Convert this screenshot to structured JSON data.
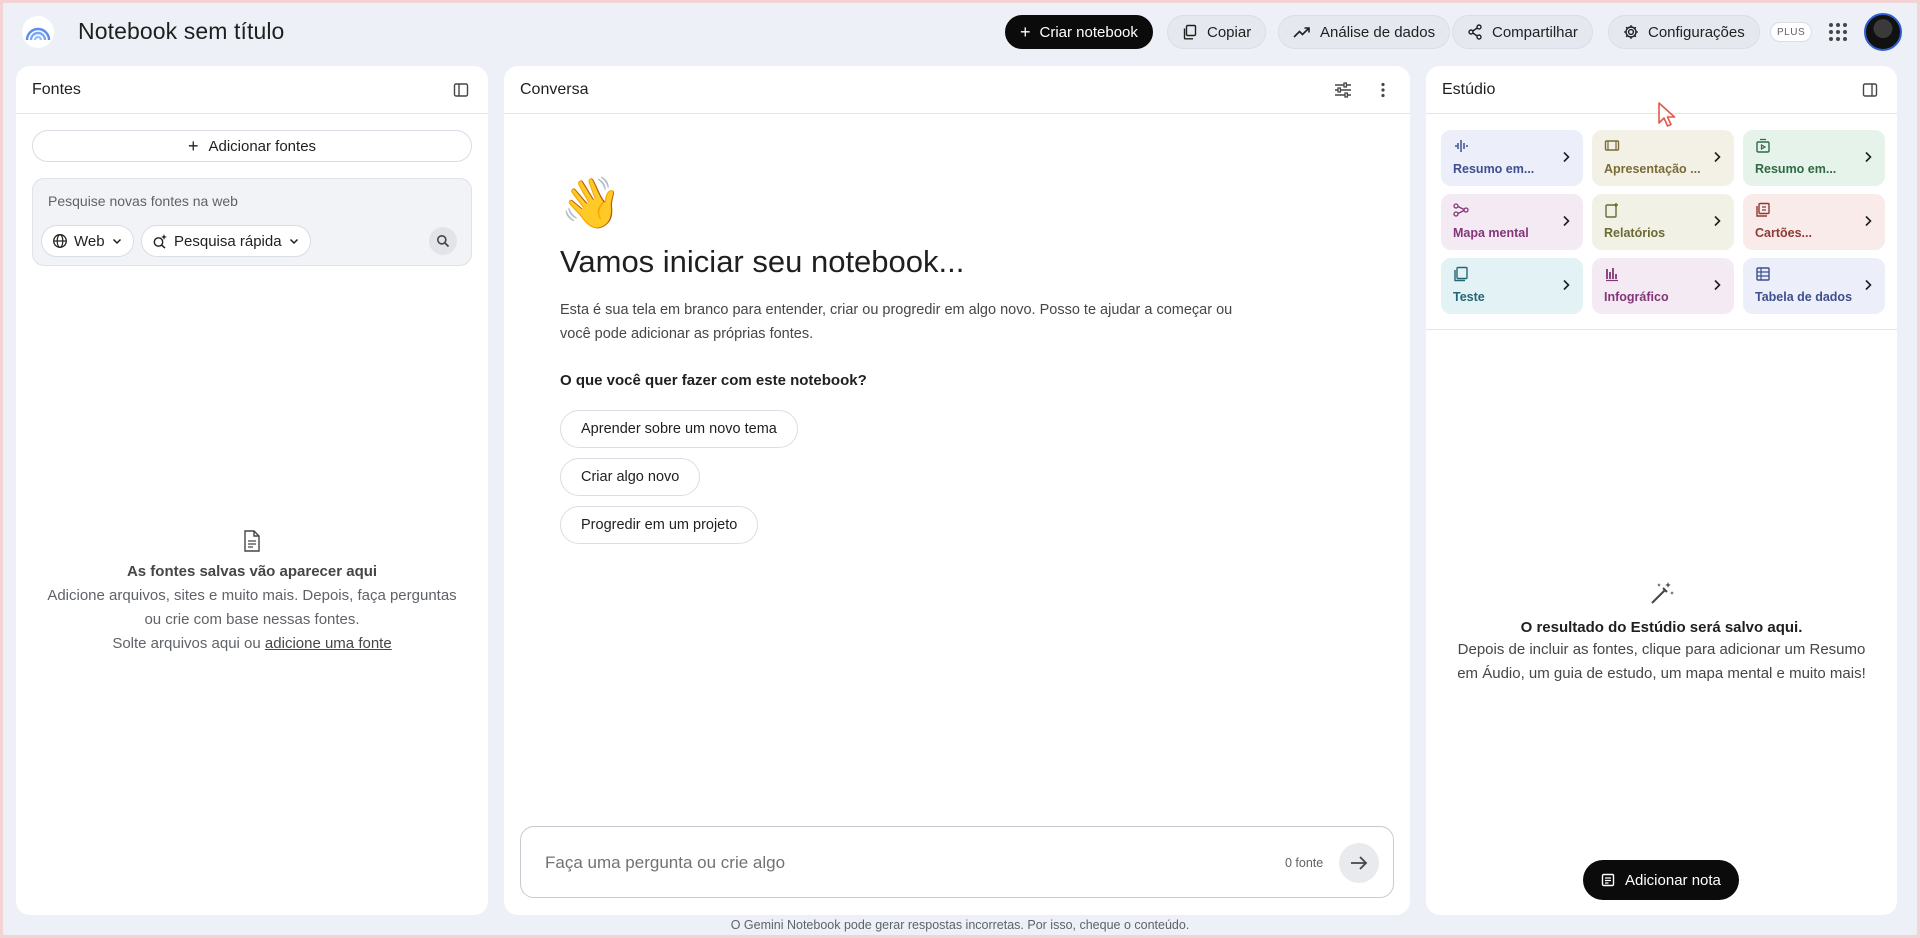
{
  "header": {
    "title": "Notebook sem título",
    "create_label": "Criar notebook",
    "copy_label": "Copiar",
    "analysis_label": "Análise de dados",
    "share_label": "Compartilhar",
    "settings_label": "Configurações",
    "plan_badge": "PLUS"
  },
  "sources": {
    "title": "Fontes",
    "add_label": "Adicionar fontes",
    "search_placeholder": "Pesquise novas fontes na web",
    "web_chip": "Web",
    "research_chip": "Pesquisa rápida",
    "empty_title": "As fontes salvas vão aparecer aqui",
    "empty_desc": "Adicione arquivos, sites e muito mais. Depois, faça perguntas ou crie com base nessas fontes.",
    "drop_prefix": "Solte arquivos aqui ou ",
    "drop_link": "adicione uma fonte"
  },
  "chat": {
    "title": "Conversa",
    "greeting_emoji": "👋",
    "heading": "Vamos iniciar seu notebook...",
    "description": "Esta é sua tela em branco para entender, criar ou progredir em algo novo. Posso te ajudar a começar ou você pode adicionar as próprias fontes.",
    "question": "O que você quer fazer com este notebook?",
    "suggestions": [
      "Aprender sobre um novo tema",
      "Criar algo novo",
      "Progredir em um projeto"
    ],
    "input_placeholder": "Faça uma pergunta ou crie algo",
    "source_count": "0 fonte"
  },
  "studio": {
    "title": "Estúdio",
    "tiles": [
      {
        "label": "Resumo em...",
        "icon": "audio-waveform-icon",
        "bg": "#eceff9",
        "fg": "#3d4f8f"
      },
      {
        "label": "Apresentação ...",
        "icon": "slides-icon",
        "bg": "#f3f1e6",
        "fg": "#7a6b38"
      },
      {
        "label": "Resumo em...",
        "icon": "video-icon",
        "bg": "#e5f3ea",
        "fg": "#2f6a45"
      },
      {
        "label": "Mapa mental",
        "icon": "mind-map-icon",
        "bg": "#f4eaf3",
        "fg": "#84367a"
      },
      {
        "label": "Relatórios",
        "icon": "reports-icon",
        "bg": "#f1f1e6",
        "fg": "#6b6a32"
      },
      {
        "label": "Cartões...",
        "icon": "flashcards-icon",
        "bg": "#f8ebea",
        "fg": "#8e3a35"
      },
      {
        "label": "Teste",
        "icon": "quiz-icon",
        "bg": "#e3f2f5",
        "fg": "#256677"
      },
      {
        "label": "Infográfico",
        "icon": "infographic-icon",
        "bg": "#f4eaf3",
        "fg": "#84367a"
      },
      {
        "label": "Tabela de dados",
        "icon": "data-table-icon",
        "bg": "#eceff9",
        "fg": "#3d4f8f"
      }
    ],
    "empty_title": "O resultado do Estúdio será salvo aqui.",
    "empty_desc": "Depois de incluir as fontes, clique para adicionar um Resumo em Áudio, um guia de estudo, um mapa mental e muito mais!",
    "add_note_label": "Adicionar nota"
  },
  "footer": {
    "disclaimer": "O Gemini Notebook pode gerar respostas incorretas. Por isso, cheque o conteúdo."
  }
}
